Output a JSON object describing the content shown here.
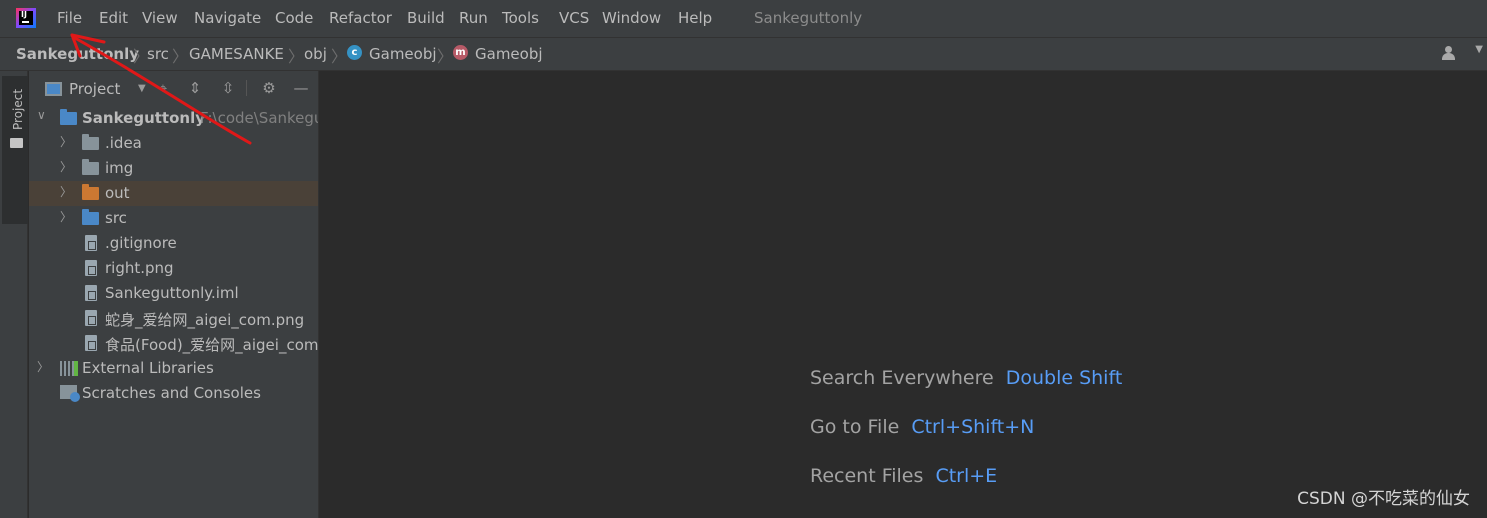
{
  "menubar": {
    "items": [
      {
        "label": "File"
      },
      {
        "label": "Edit"
      },
      {
        "label": "View"
      },
      {
        "label": "Navigate"
      },
      {
        "label": "Code"
      },
      {
        "label": "Refactor"
      },
      {
        "label": "Build"
      },
      {
        "label": "Run"
      },
      {
        "label": "Tools"
      },
      {
        "label": "VCS"
      },
      {
        "label": "Window"
      },
      {
        "label": "Help"
      }
    ],
    "window_title": "Sankeguttonly"
  },
  "breadcrumb": {
    "items": [
      "Sankeguttonly",
      "src",
      "GAMESANKE",
      "obj",
      "Gameobj",
      "Gameobj"
    ],
    "class_badge": "c",
    "method_badge": "m"
  },
  "toolstrip": {
    "project_tab_label": "Project"
  },
  "project_panel": {
    "title": "Project",
    "root": {
      "name": "Sankeguttonly",
      "path": "F:\\code\\Sankeguttonly"
    },
    "items": [
      {
        "label": ".idea"
      },
      {
        "label": "img"
      },
      {
        "label": "out"
      },
      {
        "label": "src"
      },
      {
        "label": ".gitignore"
      },
      {
        "label": "right.png"
      },
      {
        "label": "Sankeguttonly.iml"
      },
      {
        "label": "蛇身_爱给网_aigei_com.png"
      },
      {
        "label": "食品(Food)_爱给网_aigei_com.png"
      },
      {
        "label": "External Libraries"
      },
      {
        "label": "Scratches and Consoles"
      }
    ]
  },
  "editor_hints": [
    {
      "label": "Search Everywhere",
      "key": "Double Shift"
    },
    {
      "label": "Go to File",
      "key": "Ctrl+Shift+N"
    },
    {
      "label": "Recent Files",
      "key": "Ctrl+E"
    }
  ],
  "watermark": "CSDN @不吃菜的仙女",
  "colors": {
    "accent_key": "#589df6",
    "selected_row": "#4a4138",
    "annotation_arrow": "#e01818"
  }
}
